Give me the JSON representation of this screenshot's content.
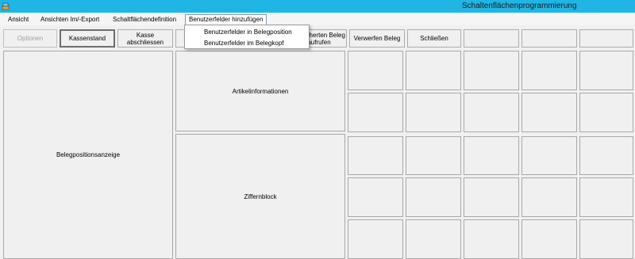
{
  "window": {
    "title": "Schaltenflächenprogrammierung"
  },
  "menu": {
    "items": [
      "Ansicht",
      "Ansichten Im/-Export",
      "Schaltflächendefinition",
      "Benutzerfelder hinzufügen"
    ],
    "dropdown": [
      "Benutzerfelder in Belegposition",
      "Benutzerfelder im Belegkopf"
    ]
  },
  "toolbar": {
    "optionen": "Optionen",
    "kassenstand": "Kassenstand",
    "kasse_abschliessen": "Kasse abschliessen",
    "beleg_aufrufen": "Gesicherten Beleg aufrufen",
    "verwerfen_beleg": "Verwerfen Beleg",
    "schliessen": "Schließen"
  },
  "panels": {
    "belegpositionsanzeige": "Belegpositionsanzeige",
    "artikelinformationen": "Artikelinformationen",
    "ziffernblock": "Ziffernblock"
  },
  "colors": {
    "titlebar": "#1fb6e6",
    "menubar": "#f5f5f5",
    "background": "#f0f0f0"
  }
}
